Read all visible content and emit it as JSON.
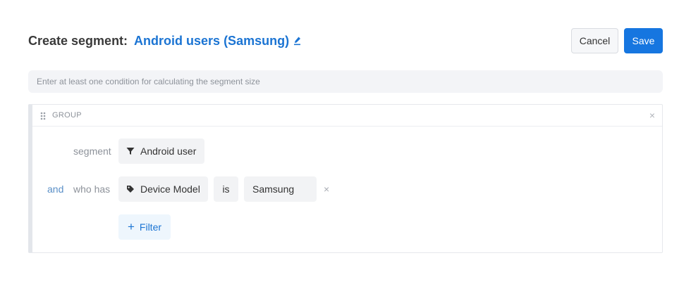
{
  "header": {
    "title_label": "Create segment:",
    "segment_name": "Android users (Samsung)",
    "cancel_label": "Cancel",
    "save_label": "Save"
  },
  "hint": {
    "text": "Enter at least one condition for calculating the segment size"
  },
  "group": {
    "label": "GROUP",
    "close_glyph": "×",
    "conditions": [
      {
        "prefix": "",
        "label": "segment",
        "chip": "Android user",
        "chip_icon": "filter-icon"
      },
      {
        "prefix": "and",
        "label": "who has",
        "property": "Device Model",
        "property_icon": "tag-icon",
        "operator": "is",
        "value": "Samsung",
        "remove_glyph": "×"
      }
    ],
    "add_filter_label": "Filter",
    "add_filter_glyph": "+"
  },
  "colors": {
    "accent": "#1676e0",
    "link": "#1b74d3",
    "muted_text": "#8d929a"
  }
}
